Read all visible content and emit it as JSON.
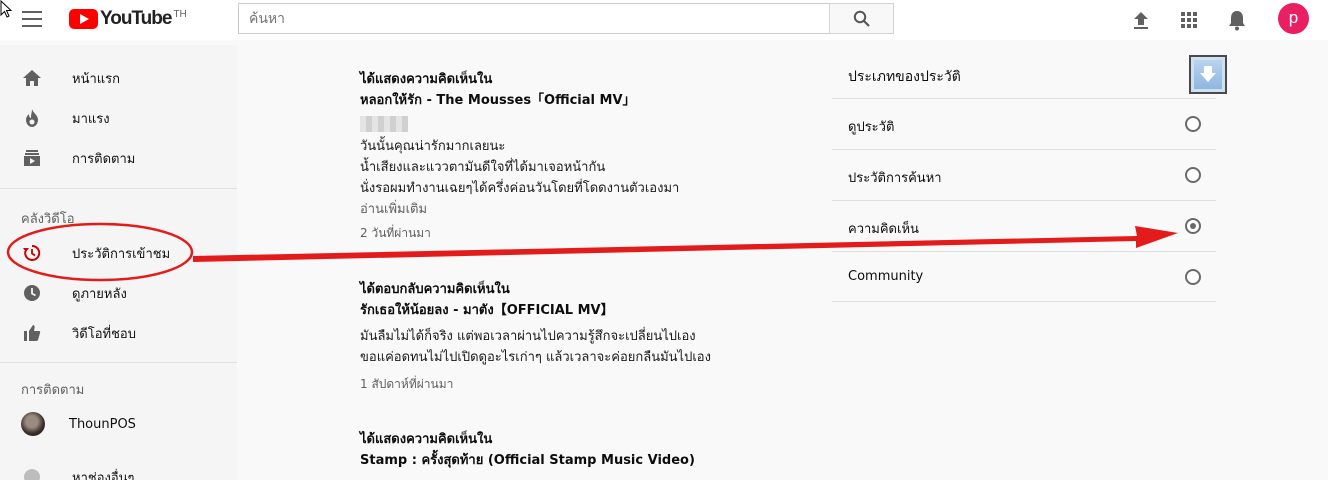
{
  "header": {
    "logo_text": "YouTube",
    "logo_region": "TH",
    "search_placeholder": "ค้นหา",
    "avatar_letter": "p",
    "colors": {
      "brand": "#ff0000",
      "avatar": "#e91e63"
    },
    "icons": [
      "menu-icon",
      "search-icon",
      "upload-icon",
      "apps-icon",
      "bell-icon"
    ]
  },
  "sidebar": {
    "items": [
      {
        "label": "หน้าแรก",
        "icon": "home-icon"
      },
      {
        "label": "มาแรง",
        "icon": "fire-icon"
      },
      {
        "label": "การติดตาม",
        "icon": "subscriptions-icon"
      }
    ],
    "library_heading": "คลังวิดีโอ",
    "library_items": [
      {
        "label": "ประวัติการเข้าชม",
        "icon": "history-icon",
        "active": true
      },
      {
        "label": "ดูภายหลัง",
        "icon": "clock-icon"
      },
      {
        "label": "วิดีโอที่ชอบ",
        "icon": "thumbs-up-icon"
      }
    ],
    "subs_heading": "การติดตาม",
    "subscriptions": [
      {
        "label": "ThounPOS"
      }
    ],
    "partial_item": "หาช่องอื่นๆ"
  },
  "feed": {
    "entries": [
      {
        "action": "ได้แสดงความคิดเห็นใน",
        "title": "หลอกให้รัก - The Mousses「Official MV」",
        "lines": [
          "วันนั้นคุณน่ารักมากเลยนะ",
          "น้ำเสียงและแววตามันดีใจที่ได้มาเจอหน้ากัน",
          "นั่งรอผมทำงานเฉยๆได้ครึ่งค่อนวันโดยที่โดดงานตัวเองมา"
        ],
        "more": "อ่านเพิ่มเติม",
        "time": "2 วันที่ผ่านมา"
      },
      {
        "action": "ได้ตอบกลับความคิดเห็นใน",
        "title": "รักเธอให้น้อยลง - มาตัง【OFFICIAL MV】",
        "lines": [
          "มันลืมไม่ได้ก็จริง แต่พอเวลาผ่านไปความรู้สึกจะเปลี่ยนไปเอง",
          "ขอแค่อดทนไม่ไปเปิดดูอะไรเก่าๆ แล้วเวลาจะค่อยกลืนมันไปเอง"
        ],
        "time": "1 สัปดาห์ที่ผ่านมา"
      },
      {
        "action": "ได้แสดงความคิดเห็นใน",
        "title": "Stamp : ครั้งสุดท้าย (Official Stamp Music Video)"
      }
    ]
  },
  "panel": {
    "title": "ประเภทของประวัติ",
    "options": [
      {
        "label": "ดูประวัติ",
        "selected": false
      },
      {
        "label": "ประวัติการค้นหา",
        "selected": false
      },
      {
        "label": "ความคิดเห็น",
        "selected": true
      },
      {
        "label": "Community",
        "selected": false
      }
    ]
  },
  "annotation": {
    "color": "#e31b1b"
  }
}
